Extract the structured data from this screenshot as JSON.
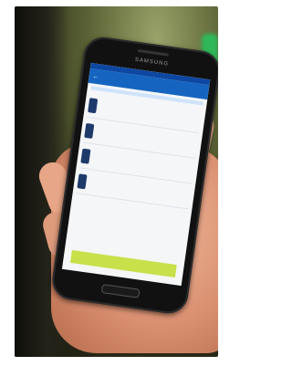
{
  "image": {
    "phone_brand": "SAMSUNG",
    "app": {
      "title": "",
      "notice": "",
      "items": [
        {
          "name": "",
          "sub": "",
          "price": ""
        },
        {
          "name": "",
          "sub": "",
          "price": ""
        },
        {
          "name": "",
          "sub": "",
          "price": ""
        },
        {
          "name": "",
          "sub": "",
          "price": ""
        }
      ],
      "total_label": "",
      "total_value": "",
      "cta_label": ""
    }
  }
}
